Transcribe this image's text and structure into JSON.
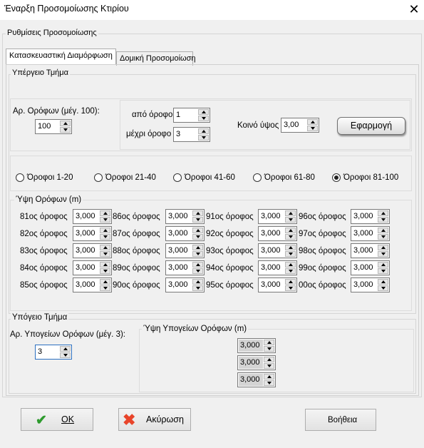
{
  "window": {
    "title": "Έναρξη Προσομοίωσης Κτιρίου",
    "close_glyph": "✕"
  },
  "settings_group": "Ρυθμίσεις Προσομοίωσης",
  "tabs": [
    {
      "label": "Κατασκευαστική Διαμόρφωση",
      "active": true
    },
    {
      "label": "Δομική Προσομοίωση",
      "active": false
    }
  ],
  "above_ground": {
    "title": "Υπέργειο Τμήμα",
    "floors_count_label": "Αρ. Ορόφων (μέγ. 100):",
    "floors_count_value": "100",
    "from_floor_label": "από όροφο",
    "from_floor_value": "1",
    "to_floor_label": "μέχρι όροφο",
    "to_floor_value": "3",
    "common_height_label": "Κοινό ύψος",
    "common_height_value": "3,00",
    "apply_label": "Εφαρμογή"
  },
  "range_radios": [
    {
      "label": "Όροφοι 1-20",
      "checked": false
    },
    {
      "label": "Όροφοι 21-40",
      "checked": false
    },
    {
      "label": "Όροφοι 41-60",
      "checked": false
    },
    {
      "label": "Όροφοι 61-80",
      "checked": false
    },
    {
      "label": "Όροφοι 81-100",
      "checked": true
    }
  ],
  "heights": {
    "title": "Ύψη Ορόφων (m)",
    "columns": [
      [
        {
          "label": "81ος όροφος",
          "value": "3,000"
        },
        {
          "label": "82ος όροφος",
          "value": "3,000"
        },
        {
          "label": "83ος όροφος",
          "value": "3,000"
        },
        {
          "label": "84ος όροφος",
          "value": "3,000"
        },
        {
          "label": "85ος όροφος",
          "value": "3,000"
        }
      ],
      [
        {
          "label": "86ος όροφος",
          "value": "3,000"
        },
        {
          "label": "87ος όροφος",
          "value": "3,000"
        },
        {
          "label": "88ος όροφος",
          "value": "3,000"
        },
        {
          "label": "89ος όροφος",
          "value": "3,000"
        },
        {
          "label": "90ος όροφος",
          "value": "3,000"
        }
      ],
      [
        {
          "label": "91ος όροφος",
          "value": "3,000"
        },
        {
          "label": "92ος όροφος",
          "value": "3,000"
        },
        {
          "label": "93ος όροφος",
          "value": "3,000"
        },
        {
          "label": "94ος όροφος",
          "value": "3,000"
        },
        {
          "label": "95ος όροφος",
          "value": "3,000"
        }
      ],
      [
        {
          "label": "96ος όροφος",
          "value": "3,000"
        },
        {
          "label": "97ος όροφος",
          "value": "3,000"
        },
        {
          "label": "98ος όροφος",
          "value": "3,000"
        },
        {
          "label": "99ος όροφος",
          "value": "3,000"
        },
        {
          "label": "00ος όροφος",
          "value": "3,000"
        }
      ]
    ]
  },
  "underground": {
    "title": "Υπόγειο Τμήμα",
    "count_label": "Αρ. Υπογείων Ορόφων (μέγ. 3):",
    "count_value": "3",
    "heights_title": "Ύψη Υπογείων Ορόφων (m)",
    "heights": [
      "3,000",
      "3,000",
      "3,000"
    ]
  },
  "footer": {
    "ok_label": "OK",
    "cancel_label": "Ακύρωση",
    "help_label": "Βοήθεια",
    "colors": {
      "ok_icon": "#2e9b2e",
      "cancel_icon": "#e8442a"
    }
  }
}
